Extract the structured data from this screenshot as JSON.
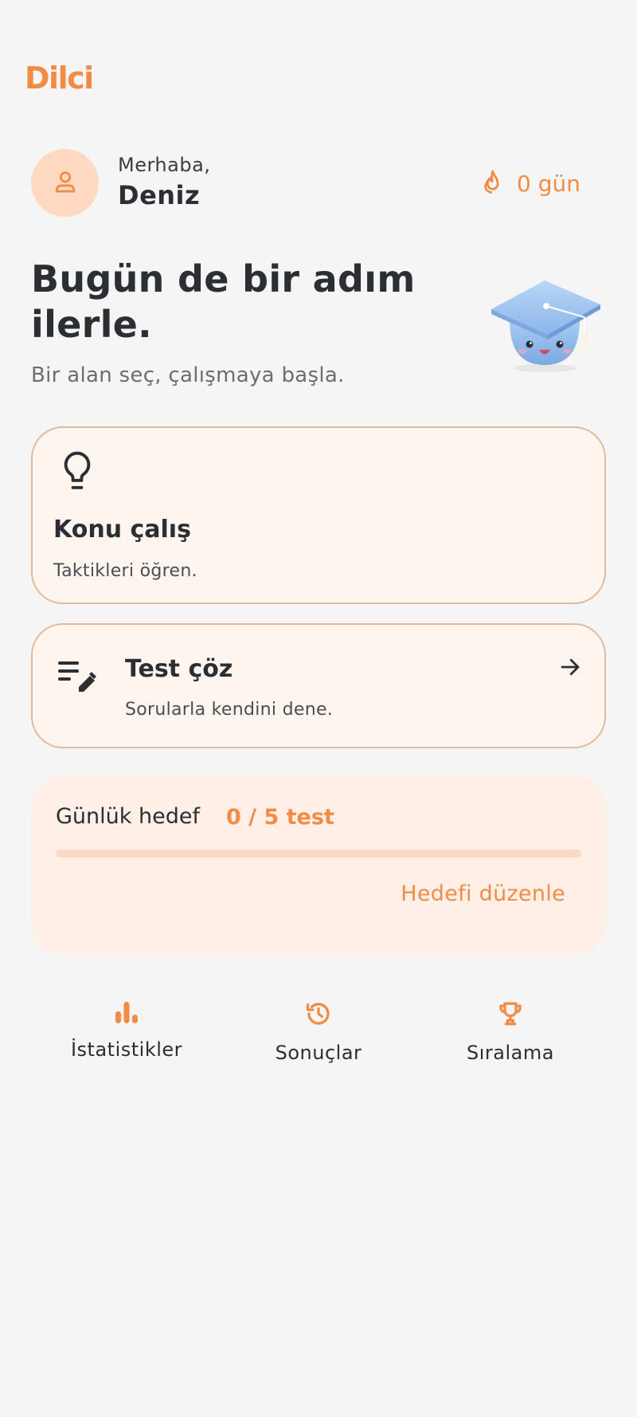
{
  "app": {
    "logo": "Dilci"
  },
  "colors": {
    "accent": "#f28c45",
    "card_bg": "#fff5ef",
    "goal_bg": "#ffefe7",
    "avatar_bg": "#ffd9c2"
  },
  "header": {
    "greeting": "Merhaba,",
    "user_name": "Deniz",
    "streak_label": "0 gün",
    "avatar_icon": "person-icon",
    "streak_icon": "flame-icon"
  },
  "hero": {
    "title": "Bugün de bir adım ilerle.",
    "subtitle": "Bir alan seç, çalışmaya başla.",
    "mascot": "graduation-cap-mascot"
  },
  "cards": {
    "learn": {
      "title": "Konu çalış",
      "desc": "Taktikleri öğren.",
      "icon": "lightbulb-icon"
    },
    "test": {
      "title": "Test çöz",
      "desc": "Sorularla kendini dene.",
      "icon": "edit-list-icon",
      "arrow_icon": "arrow-right-icon"
    }
  },
  "daily_goal": {
    "label": "Günlük hedef",
    "value": "0 / 5 test",
    "progress": 0,
    "edit_label": "Hedefi düzenle"
  },
  "shortcuts": [
    {
      "label": "İstatistikler",
      "icon": "bar-chart-icon"
    },
    {
      "label": "Sonuçlar",
      "icon": "history-icon"
    },
    {
      "label": "Sıralama",
      "icon": "trophy-icon"
    }
  ]
}
